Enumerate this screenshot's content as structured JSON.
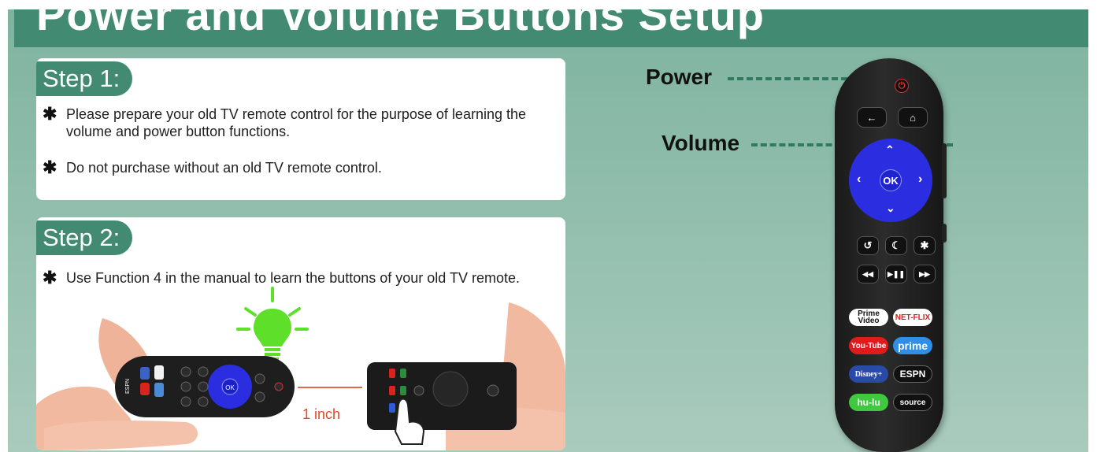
{
  "header": {
    "title": "Power and Volume Buttons Setup"
  },
  "step1": {
    "tab": "Step 1:",
    "bullets": [
      "Please prepare your old TV remote control for the purpose of learning the volume and power button functions.",
      "Do not purchase without an old TV remote control."
    ]
  },
  "step2": {
    "tab": "Step 2:",
    "bullets": [
      "Use Function 4 in the manual to learn the buttons of your old TV remote."
    ],
    "distance_label": "1 inch"
  },
  "labels": {
    "power": "Power",
    "volume": "Volume"
  },
  "remote": {
    "ok": "OK",
    "apps": {
      "prime_video": "Prime Video",
      "netflix": "NET-FLIX",
      "youtube": "You-Tube",
      "prime": "prime",
      "disney": "Disney+",
      "espn": "ESPN",
      "hulu": "hu-lu",
      "source": "source"
    }
  },
  "small_remote": {
    "ok": "OK",
    "espn": "ESPN"
  },
  "colors": {
    "accent": "#438a73",
    "background": "#a9cbbd",
    "dpad": "#2a2ee0",
    "bulb": "#5ee02a"
  }
}
